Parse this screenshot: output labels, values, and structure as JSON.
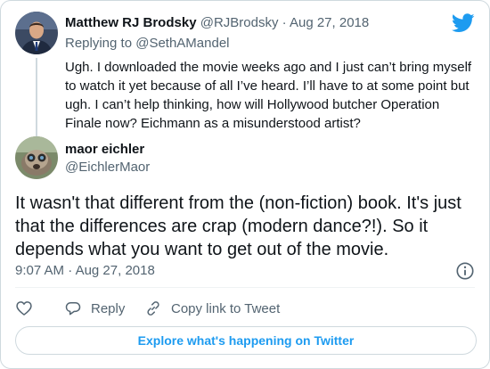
{
  "parent_tweet": {
    "author_name": "Matthew RJ Brodsky",
    "author_handle": "@RJBrodsky",
    "separator": "·",
    "date": "Aug 27, 2018",
    "replying_prefix": "Replying to",
    "replying_handle": "@SethAMandel",
    "text": "Ugh. I downloaded the movie weeks ago and I just can’t bring myself to watch it yet because of all I’ve heard. I’ll have to at some point but ugh. I can’t help thinking, how will Hollywood butcher Operation Finale now? Eichmann as a misunderstood artist?"
  },
  "main_tweet": {
    "author_name": "maor eichler",
    "author_handle": "@EichlerMaor",
    "text": "It wasn't that different from the (non-fiction) book. It's just that the differences are crap (modern dance?!). So it depends what you want to get out of the movie.",
    "time": "9:07 AM",
    "separator": "·",
    "date": "Aug 27, 2018"
  },
  "actions": {
    "reply_label": "Reply",
    "copy_label": "Copy link to Tweet"
  },
  "footer": {
    "explore_label": "Explore what's happening on Twitter"
  },
  "icons": {
    "brand": "twitter-bird-icon",
    "info": "info-icon",
    "like": "heart-icon",
    "reply": "reply-bubble-icon",
    "copy": "link-icon"
  },
  "colors": {
    "brand_blue": "#1d9bf0",
    "text_primary": "#0f1419",
    "text_secondary": "#536471",
    "border": "#cfd9de"
  }
}
